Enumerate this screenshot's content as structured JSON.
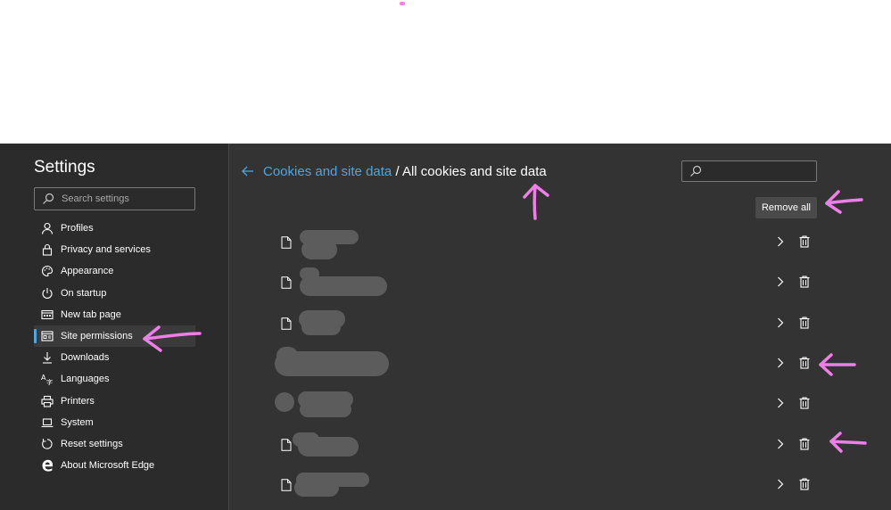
{
  "sidebar": {
    "title": "Settings",
    "search_placeholder": "Search settings",
    "items": [
      {
        "label": "Profiles",
        "icon": "person-icon"
      },
      {
        "label": "Privacy and services",
        "icon": "lock-icon"
      },
      {
        "label": "Appearance",
        "icon": "palette-icon"
      },
      {
        "label": "On startup",
        "icon": "power-icon"
      },
      {
        "label": "New tab page",
        "icon": "new-tab-icon"
      },
      {
        "label": "Site permissions",
        "icon": "site-permissions-icon",
        "active": true
      },
      {
        "label": "Downloads",
        "icon": "download-icon"
      },
      {
        "label": "Languages",
        "icon": "languages-icon"
      },
      {
        "label": "Printers",
        "icon": "printer-icon"
      },
      {
        "label": "System",
        "icon": "laptop-icon"
      },
      {
        "label": "Reset settings",
        "icon": "reset-icon"
      },
      {
        "label": "About Microsoft Edge",
        "icon": "edge-logo-icon"
      }
    ]
  },
  "header": {
    "breadcrumb_link": "Cookies and site data",
    "breadcrumb_sep": "/",
    "breadcrumb_current": "All cookies and site data"
  },
  "site_search": {
    "placeholder": ""
  },
  "remove_all_label": "Remove all",
  "rows_count_visible": 7,
  "colors": {
    "accent": "#4fa6e0",
    "background": "#333333",
    "sidebar": "#2b2b2b",
    "annotation": "#f07ee8"
  }
}
